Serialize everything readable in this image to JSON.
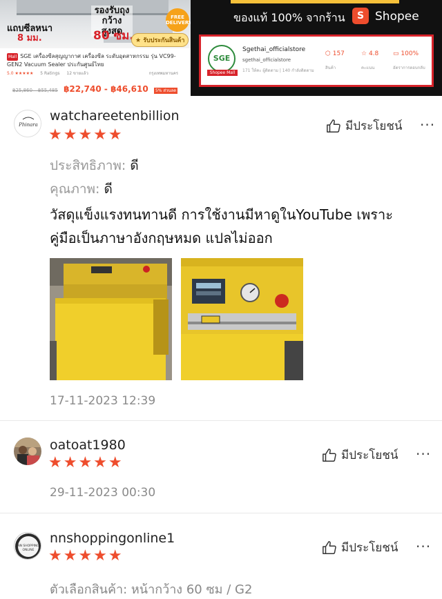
{
  "banner": {
    "ad_left": {
      "width_label": "แถบซีลหนา",
      "width_value": "8 มม.",
      "bag_label": "รองรับถุงกว้างสูงสุด",
      "bag_value": "80 ซม.",
      "free_delivery": "FREE DELIVERY",
      "guarantee": "รับประกันสินค้า",
      "mall_tag": "Mall",
      "product_title": "SGE เครื่องซีลสุญญากาศ เครื่องซีล ระดับอุตสาหกรรม รุ่น VC99-GEN2 Vacuum Sealer ประกันศูนย์ไทย",
      "rating": "5.0 ★★★★★",
      "ratings_count": "5 Ratings",
      "sold": "12 ขายแล้ว",
      "location": "กรุงเทพมหานคร",
      "old_price": "฿25,860 – ฿55,485",
      "price": "฿22,740 - ฿46,610",
      "discount": "5% ส่วนลด"
    },
    "ad_right": {
      "genuine_text": "ของแท้ 100% จากร้าน",
      "shopee_brand": "Shopee",
      "store_name": "Sgethai_officialstore",
      "store_handle": "sgethai_officialstore",
      "store_meta": "171 ให้คะ ผู้ติดตาม | 140 กำลังติดตาม",
      "store_logo_text": "SGE",
      "store_mall_label": "Shopee Mall",
      "stats": [
        {
          "value": "157",
          "label": "สินค้า"
        },
        {
          "value": "4.8",
          "label": "คะแนน"
        },
        {
          "value": "100%",
          "label": "อัตราการตอบกลับ"
        }
      ]
    }
  },
  "helpful_label": "มีประโยชน์",
  "more_label": "···",
  "reviews": [
    {
      "username": "watchareetenbillion",
      "avatar_text": "Phinara",
      "stars": "★★★★★",
      "rating": 5,
      "attr1_label": "ประสิทธิภาพ:",
      "attr1_value": "ดี",
      "attr2_label": "คุณภาพ:",
      "attr2_value": "ดี",
      "body_line1": "วัสดุแข็งแรงทนทานดี การใช้งานมีหาดูในYouTube เพราะ",
      "body_line2": "คู่มือเป็นภาษาอังกฤษหมด แปลไม่ออก",
      "timestamp": "17-11-2023 12:39"
    },
    {
      "username": "oatoat1980",
      "stars": "★★★★★",
      "rating": 5,
      "timestamp": "29-11-2023 00:30"
    },
    {
      "username": "nnshoppingonline1",
      "avatar_text": "NN SHOPPING ONLINE",
      "stars": "★★★★★",
      "rating": 5,
      "partial_text": "ตัวเลือกสินค้า: หน้ากว้าง 60 ซม / G2"
    }
  ],
  "colors": {
    "accent": "#ee4d2d",
    "mall_red": "#d8232a",
    "muted_text": "#999999",
    "machine_yellow": "#e8c52a"
  }
}
